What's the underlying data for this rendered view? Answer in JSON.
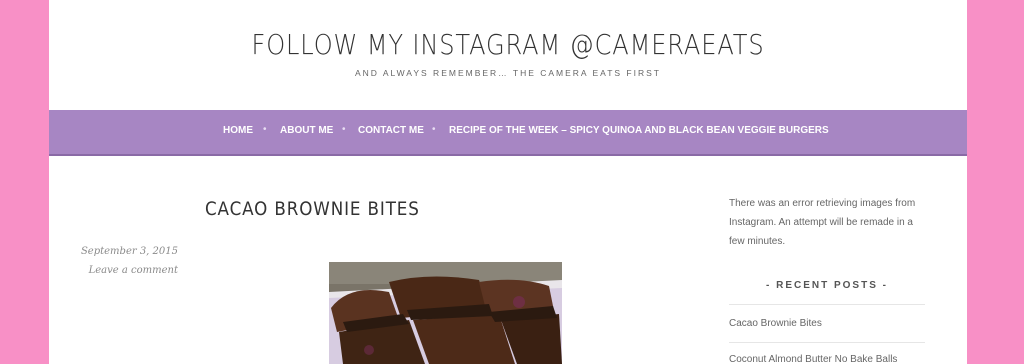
{
  "header": {
    "title": "FOLLOW MY INSTAGRAM @CAMERAEATS",
    "tagline": "AND ALWAYS REMEMBER… THE CAMERA EATS FIRST"
  },
  "nav": {
    "items": [
      {
        "label": "HOME"
      },
      {
        "label": "ABOUT ME"
      },
      {
        "label": "CONTACT ME"
      },
      {
        "label": "RECIPE OF THE WEEK – SPICY QUINOA AND BLACK BEAN VEGGIE BURGERS"
      }
    ],
    "separator": "•"
  },
  "post": {
    "title": "CACAO BROWNIE BITES",
    "date": "September 3, 2015",
    "comment_link": "Leave a comment"
  },
  "sidebar": {
    "instagram_error": "There was an error retrieving images from Instagram. An attempt will be remade in a few minutes.",
    "recent_posts_title": "- RECENT POSTS -",
    "recent_posts": [
      {
        "label": "Cacao Brownie Bites"
      },
      {
        "label": "Coconut Almond Butter No Bake Balls"
      }
    ]
  },
  "colors": {
    "background": "#f890c6",
    "nav": "#a786c3"
  }
}
